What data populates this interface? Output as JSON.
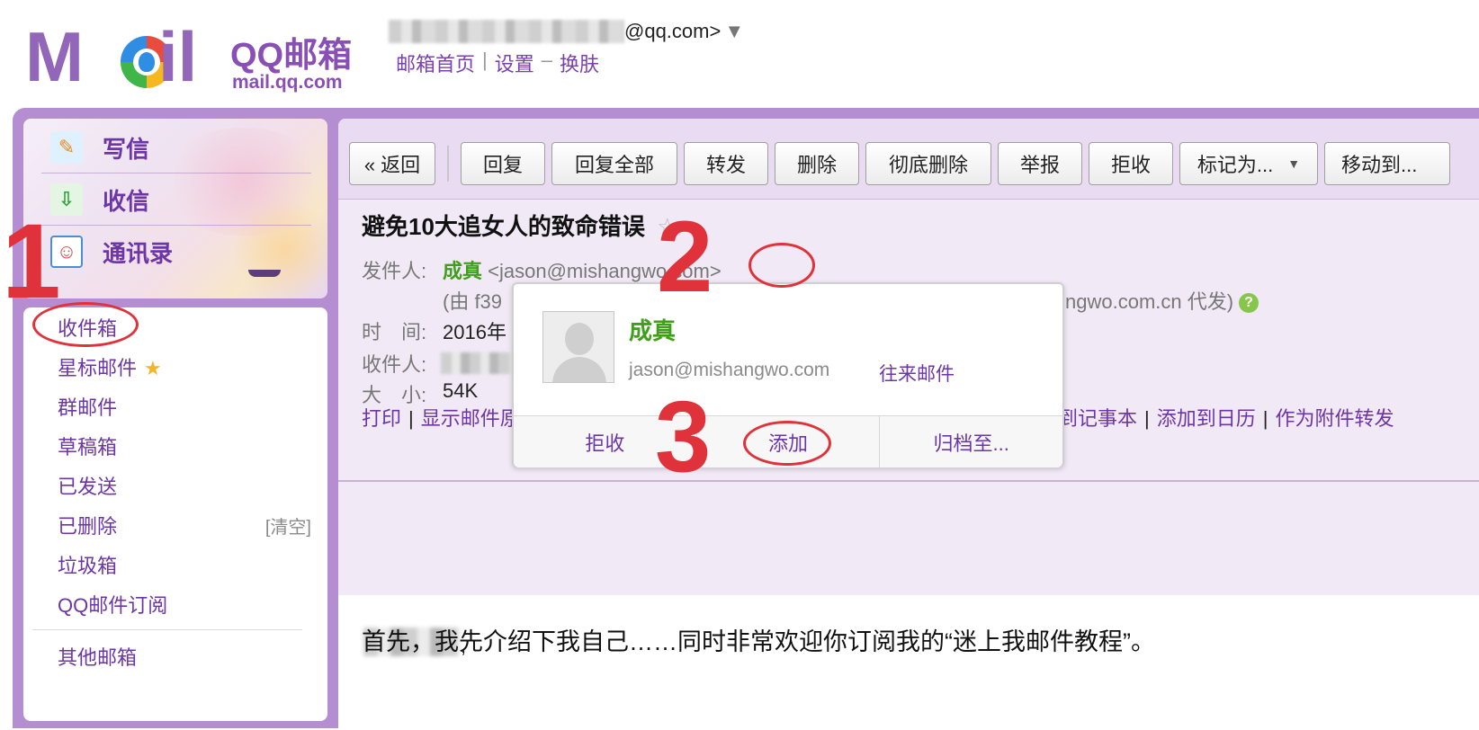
{
  "header": {
    "brand_title": "QQ邮箱",
    "brand_domain": "mail.qq.com",
    "account_suffix": "@qq.com>",
    "account_caret": "▼",
    "links": [
      "邮箱首页",
      "设置",
      "换肤"
    ],
    "link_seps": [
      "|",
      "–"
    ]
  },
  "sidebar": {
    "actions": [
      {
        "label": "写信",
        "icon": "pen-icon"
      },
      {
        "label": "收信",
        "icon": "inbox-download-icon"
      },
      {
        "label": "通讯录",
        "icon": "contacts-icon"
      }
    ],
    "folders": [
      "收件箱",
      "星标邮件",
      "群邮件",
      "草稿箱",
      "已发送",
      "已删除",
      "垃圾箱",
      "QQ邮件订阅",
      "其他邮箱"
    ],
    "clear_label": "[清空]",
    "star_glyph": "★"
  },
  "toolbar": {
    "back": "« 返回",
    "buttons": [
      "回复",
      "回复全部",
      "转发",
      "删除",
      "彻底删除",
      "举报",
      "拒收",
      "标记为...",
      "移动到..."
    ],
    "dropdown_caret": "▼"
  },
  "message": {
    "subject": "避免10大追女人的致命错误",
    "from_label": "发件人:",
    "sender_name": "成真",
    "sender_email": "<jason@mishangwo.com>",
    "via_prefix": "(由 f39",
    "via_suffix": "ngwo.com.cn 代发)",
    "help_glyph": "?",
    "time_label": "时　间:",
    "time_value": "2016年",
    "to_label": "收件人:",
    "size_label": "大　小:",
    "size_value": "54K",
    "links_left": [
      "打印",
      "显示邮件原"
    ],
    "links_right": [
      "到记事本",
      "添加到日历",
      "作为附件转发"
    ],
    "link_sep": "|",
    "greeting_comma": ",",
    "body": "首先，我先介绍下我自己……同时非常欢迎你订阅我的“迷上我邮件教程”。"
  },
  "popup": {
    "name": "成真",
    "email": "jason@mishangwo.com",
    "history": "往来邮件",
    "actions": [
      "拒收",
      "添加",
      "归档至..."
    ]
  },
  "annotations": {
    "steps": [
      "1",
      "2",
      "3"
    ],
    "accent": "#e0323b"
  },
  "colors": {
    "brand_purple": "#8a4fb5",
    "link_purple": "#6c36a6",
    "sender_green": "#3f9f1a",
    "frame_purple": "#b58dd1"
  }
}
